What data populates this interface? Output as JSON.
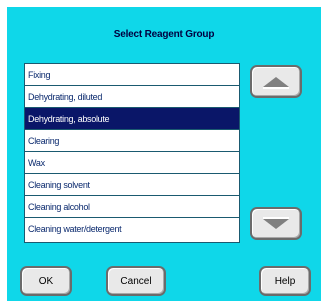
{
  "dialog": {
    "title": "Select Reagent Group",
    "background": "#0fd7e9"
  },
  "list": {
    "items": [
      {
        "label": "Fixing",
        "selected": false
      },
      {
        "label": "Dehydrating, diluted",
        "selected": false
      },
      {
        "label": "Dehydrating, absolute",
        "selected": true
      },
      {
        "label": "Clearing",
        "selected": false
      },
      {
        "label": "Wax",
        "selected": false
      },
      {
        "label": "Cleaning solvent",
        "selected": false
      },
      {
        "label": "Cleaning alcohol",
        "selected": false
      },
      {
        "label": "Cleaning water/detergent",
        "selected": false
      }
    ],
    "selected_color": "#0a1668"
  },
  "scroll": {
    "up_icon": "triangle-up-icon",
    "down_icon": "triangle-down-icon"
  },
  "buttons": {
    "ok_label": "OK",
    "cancel_label": "Cancel",
    "help_label": "Help"
  }
}
